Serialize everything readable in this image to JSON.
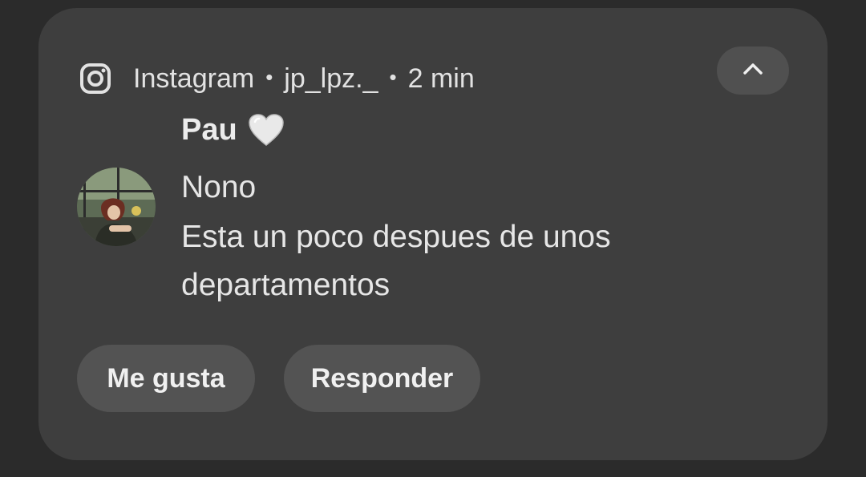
{
  "notification": {
    "app_name": "Instagram",
    "separator": "•",
    "account": "jp_lpz._",
    "time": "2 min",
    "app_icon": "instagram-icon",
    "collapse_icon": "chevron-up-icon",
    "sender": "Pau",
    "sender_emoji": "white-heart-icon",
    "messages": [
      "Nono",
      "Esta un poco despues de unos departamentos"
    ],
    "actions": {
      "like_label": "Me gusta",
      "reply_label": "Responder"
    }
  },
  "colors": {
    "background": "#2b2b2b",
    "card": "#3e3e3e",
    "button": "#535353",
    "text": "#e6e6e6"
  }
}
